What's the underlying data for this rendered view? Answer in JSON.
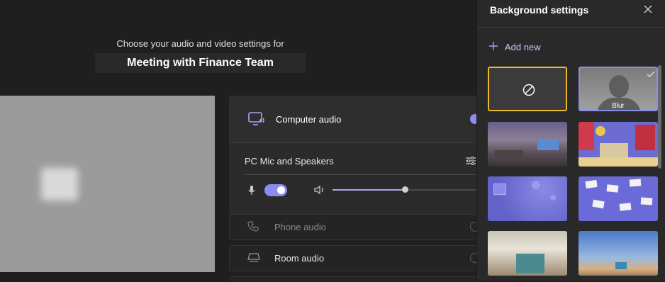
{
  "main": {
    "subtitle": "Choose your audio and video settings for",
    "meeting_title": "Meeting with Finance Team"
  },
  "audio": {
    "computer_audio_label": "Computer audio",
    "device_label": "PC Mic and Speakers",
    "mic_enabled": true,
    "volume_level": 0.5,
    "phone_audio_label": "Phone audio",
    "room_audio_label": "Room audio"
  },
  "side": {
    "title": "Background settings",
    "add_new_label": "Add new",
    "blur_label": "Blur",
    "backgrounds": [
      {
        "name": "none",
        "selected": false
      },
      {
        "name": "blur",
        "selected": true
      },
      {
        "name": "living-room"
      },
      {
        "name": "bookshelf-room"
      },
      {
        "name": "purple-bubbles"
      },
      {
        "name": "post-it-wall"
      },
      {
        "name": "office-loft"
      },
      {
        "name": "beach"
      }
    ]
  },
  "colors": {
    "accent": "#8b8cf0",
    "selected_border": "#f0b92b",
    "background": "#1f1f1f",
    "panel": "#292929"
  }
}
